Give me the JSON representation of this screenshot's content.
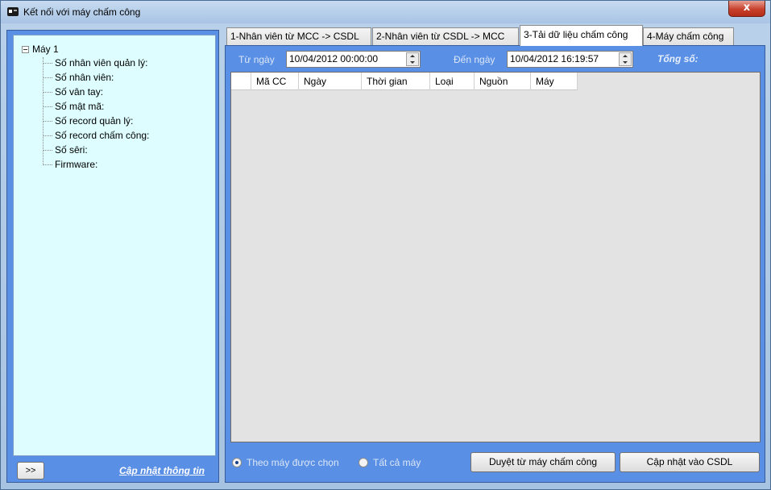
{
  "window": {
    "title": "Kết nối với máy chấm công",
    "close_glyph": "x"
  },
  "left_panel": {
    "tree": {
      "root": "Máy 1",
      "items": [
        "Số nhân viên quản lý:",
        "Số nhân viên:",
        "Số vân tay:",
        "Số mật mã:",
        "Số record quản lý:",
        "Số record chấm công:",
        "Số sêri:",
        "Firmware:"
      ]
    },
    "expand_button": ">>",
    "update_link": "Cập nhật thông tin"
  },
  "tabs": [
    {
      "label": "1-Nhân viên từ MCC -> CSDL",
      "active": false
    },
    {
      "label": "2-Nhân viên từ CSDL -> MCC",
      "active": false
    },
    {
      "label": "3-Tải dữ liệu chấm công",
      "active": true
    },
    {
      "label": "4-Máy chấm công",
      "active": false
    }
  ],
  "filter": {
    "from_label": "Từ ngày",
    "from_value": "10/04/2012 00:00:00",
    "to_label": "Đến ngày",
    "to_value": "10/04/2012 16:19:57",
    "total_label": "Tổng số:"
  },
  "grid": {
    "columns": [
      "Mã CC",
      "Ngày",
      "Thời gian",
      "Loại",
      "Nguồn",
      "Máy"
    ],
    "rows": []
  },
  "footer": {
    "radio_selected": "Theo máy được chọn",
    "radio_all": "Tất cả máy",
    "browse_button": "Duyệt từ máy chấm công",
    "update_button": "Cập nhật vào CSDL"
  },
  "colors": {
    "panel_blue": "#5a8fe6",
    "tree_bg": "#ddfdff",
    "grid_bg": "#e3e3e3"
  }
}
